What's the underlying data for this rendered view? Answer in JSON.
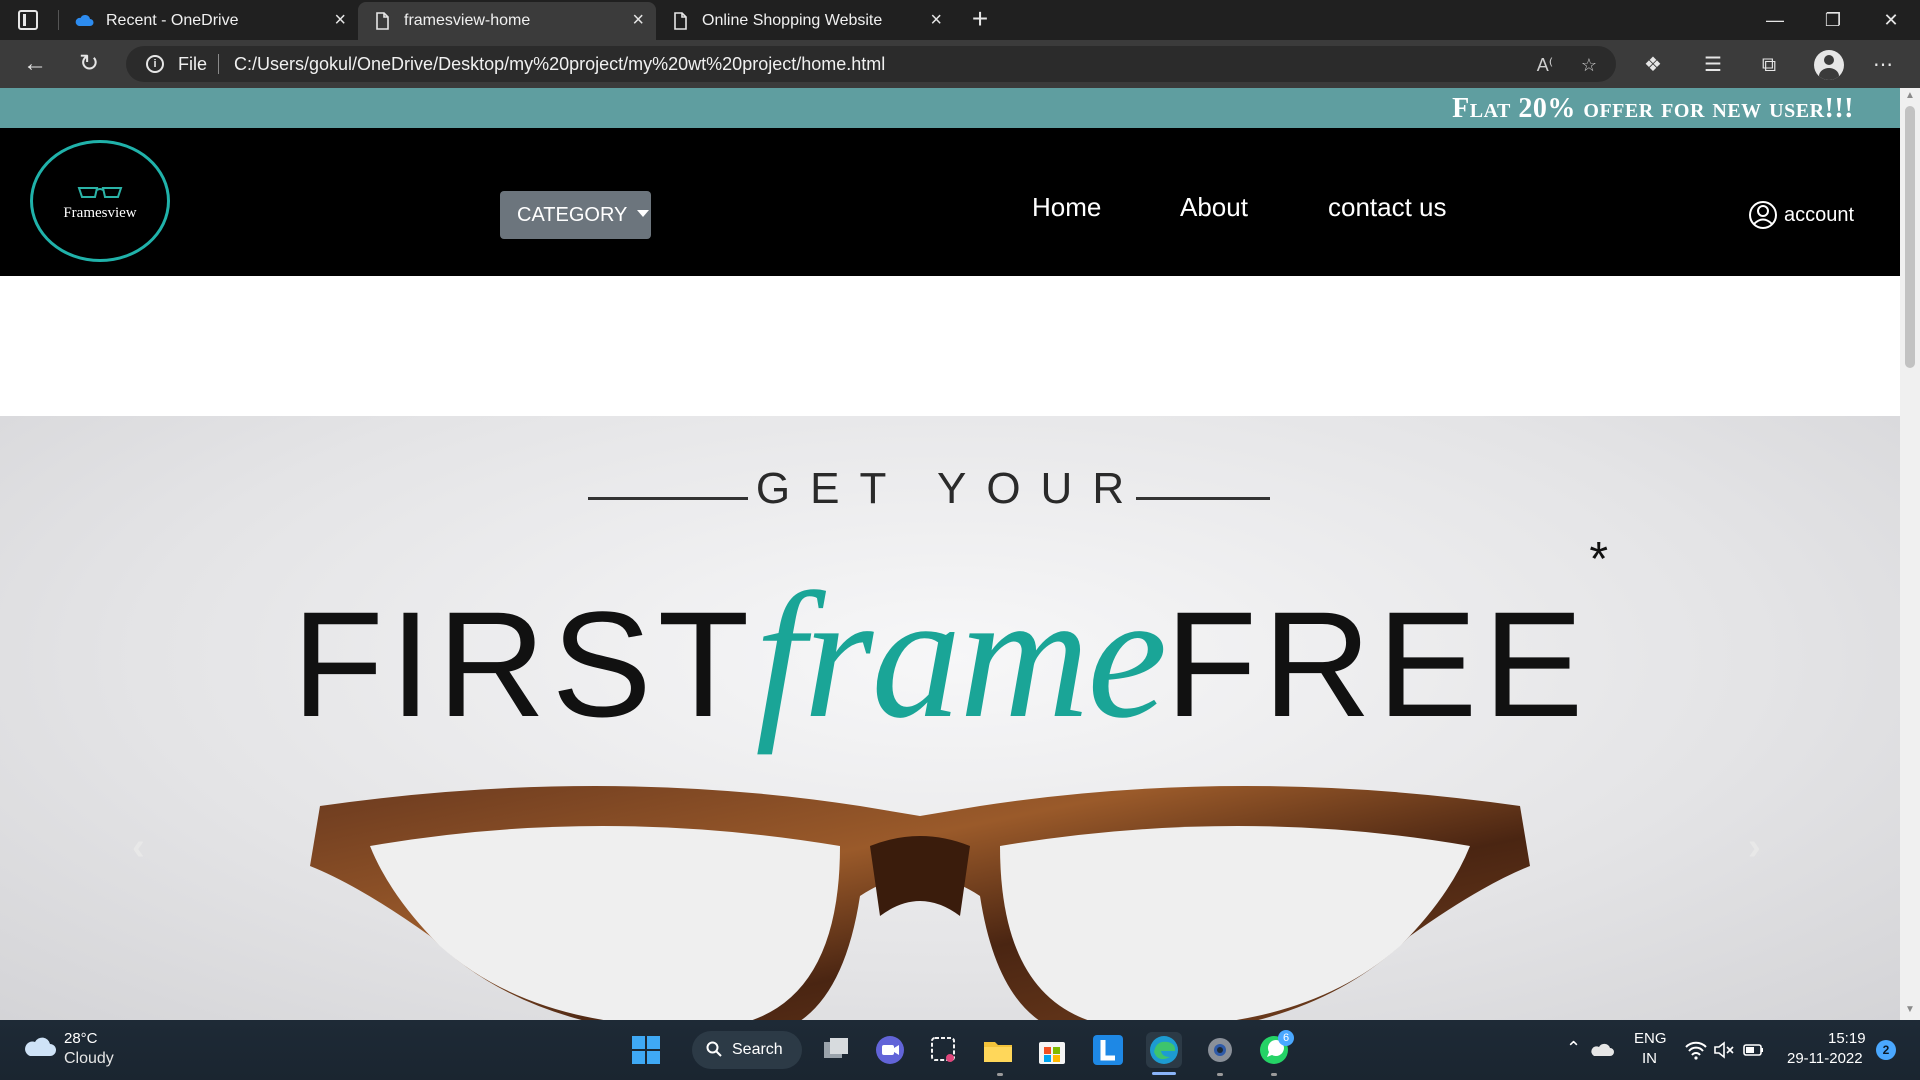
{
  "browser": {
    "tabs": [
      {
        "title": "Recent - OneDrive",
        "icon": "onedrive-cloud-icon",
        "active": false
      },
      {
        "title": "framesview-home",
        "icon": "page-icon",
        "active": true
      },
      {
        "title": "Online Shopping Website",
        "icon": "page-icon",
        "active": false
      }
    ],
    "close_glyph": "×",
    "new_tab_glyph": "+",
    "address": {
      "scheme_label": "File",
      "url": "C:/Users/gokul/OneDrive/Desktop/my%20project/my%20wt%20project/home.html"
    }
  },
  "page": {
    "offer_banner": "Flat 20% offer for new user!!!",
    "logo_text": "Framesview",
    "category_button": "CATEGORY",
    "nav": {
      "home": "Home",
      "about": "About",
      "contact": "contact us"
    },
    "account_label": "account",
    "hero": {
      "line1": "GET YOUR",
      "first": "FIRST",
      "frame": "frame",
      "free": "FREE",
      "asterisk": "*"
    },
    "carousel_prev": "‹",
    "carousel_next": "›"
  },
  "taskbar": {
    "weather": {
      "temp": "28°C",
      "condition": "Cloudy"
    },
    "search_label": "Search",
    "language": {
      "line1": "ENG",
      "line2": "IN"
    },
    "clock": {
      "time": "15:19",
      "date": "29-11-2022"
    },
    "notification_count": "2",
    "whatsapp_badge": "6"
  },
  "colors": {
    "offer_strip": "#5f9ea0",
    "header_bg": "#000000",
    "logo_ring": "#20b2aa",
    "hero_accent": "#1aa597",
    "category_btn": "#6c757d"
  }
}
